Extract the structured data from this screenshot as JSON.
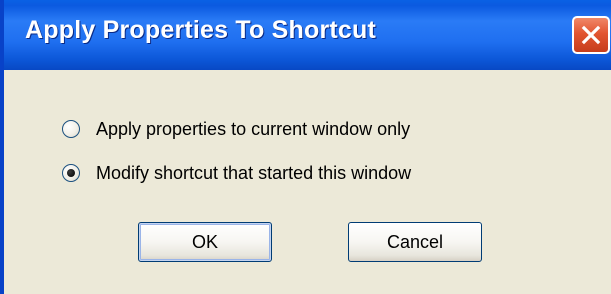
{
  "window": {
    "title": "Apply Properties To Shortcut",
    "close_icon": "close-icon"
  },
  "options": [
    {
      "label": "Apply properties to current window only",
      "checked": false
    },
    {
      "label": "Modify shortcut that started this window",
      "checked": true
    }
  ],
  "buttons": {
    "ok_label": "OK",
    "cancel_label": "Cancel"
  },
  "colors": {
    "titlebar": "#0a61e4",
    "client_background": "#ece9d8",
    "close_button": "#e25531"
  }
}
